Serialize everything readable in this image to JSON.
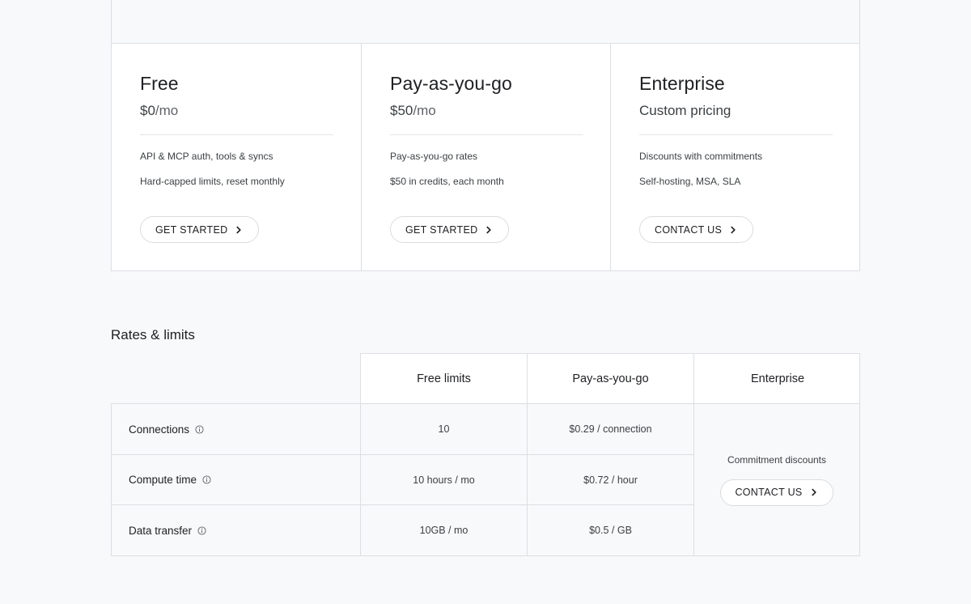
{
  "plans": [
    {
      "name": "Free",
      "price": "$0",
      "per": "/mo",
      "features": [
        "API & MCP auth, tools & syncs",
        "Hard-capped limits, reset monthly"
      ],
      "button": "GET STARTED"
    },
    {
      "name": "Pay-as-you-go",
      "price": "$50",
      "per": "/mo",
      "features": [
        "Pay-as-you-go rates",
        "$50 in credits, each month"
      ],
      "button": "GET STARTED"
    },
    {
      "name": "Enterprise",
      "price": "Custom pricing",
      "per": "",
      "features": [
        "Discounts with commitments",
        "Self-hosting, MSA, SLA"
      ],
      "button": "CONTACT US"
    }
  ],
  "rates": {
    "title": "Rates & limits",
    "headers": [
      "Free limits",
      "Pay-as-you-go",
      "Enterprise"
    ],
    "rows": [
      {
        "label": "Connections",
        "free": "10",
        "payg": "$0.29 / connection"
      },
      {
        "label": "Compute time",
        "free": "10 hours / mo",
        "payg": "$0.72 / hour"
      },
      {
        "label": "Data transfer",
        "free": "10GB / mo",
        "payg": "$0.5 / GB"
      }
    ],
    "enterprise_text": "Commitment discounts",
    "enterprise_button": "CONTACT US"
  },
  "icons": {
    "button_chevron": "chevron-right-icon",
    "row_info": "info-icon"
  },
  "colors": {
    "background": "#f8f9fa",
    "card": "#ffffff",
    "border": "#dcdfe3",
    "text": "#202124"
  }
}
